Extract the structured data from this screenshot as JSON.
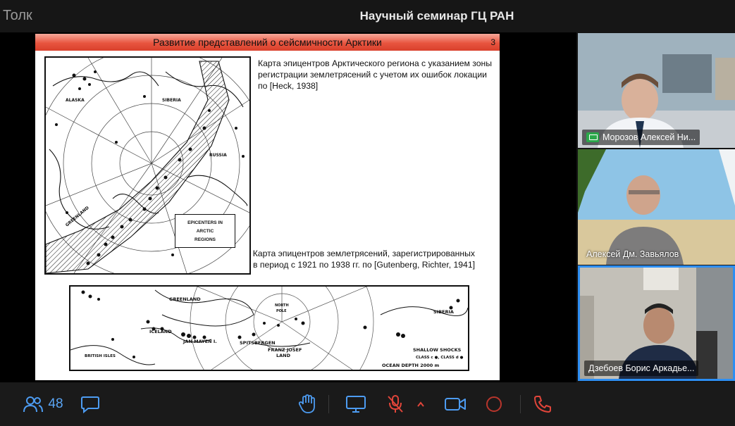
{
  "app": {
    "name": "Толк",
    "meeting_title": "Научный семинар ГЦ РАН"
  },
  "slide": {
    "title": "Развитие представлений о сейсмичности Арктики",
    "page_number": "3",
    "caption_top": "Карта эпицентров Арктического региона с указанием зоны регистрации землетрясений с учетом их ошибок локации по [Heck, 1938]",
    "caption_bottom": "Карта эпицентров землетрясений, зарегистрированных в период с 1921 по 1938 гг. по [Gutenberg, Richter, 1941]",
    "map1": {
      "legend_line1": "EPICENTERS IN",
      "legend_line2": "ARCTIC",
      "legend_line3": "REGIONS",
      "label_alaska": "ALASKA",
      "label_siberia": "SIBERIA",
      "label_russia": "RUSSIA",
      "label_greenland": "GREENLAND"
    },
    "map2": {
      "label_greenland": "GREENLAND",
      "label_siberia": "SIBERIA",
      "label_north_pole_1": "NORTH",
      "label_north_pole_2": "POLE",
      "label_iceland": "ICELAND",
      "label_jan_mayen": "JAN MAYEN I.",
      "label_spitsbergen": "SPITSBERGEN",
      "label_franz_josef_1": "FRANZ JOSEF",
      "label_franz_josef_2": "LAND",
      "label_british_isles": "BRITISH ISLES",
      "label_shallow_shocks": "SHALLOW SHOCKS",
      "label_classes": "CLASS c ●, CLASS d ●",
      "label_ocean_depth": "OCEAN DEPTH 2000 m"
    }
  },
  "participants": [
    {
      "name": "Морозов Алексей Ни...",
      "sharing_screen": true
    },
    {
      "name": "Алексей Дм. Завьялов",
      "sharing_screen": false
    },
    {
      "name": "Дзебоев Борис Аркадье...",
      "sharing_screen": false,
      "speaking": true
    }
  ],
  "toolbar": {
    "participants_count": "48",
    "icons": [
      "participants-icon",
      "chat-icon",
      "raise-hand-icon",
      "screen-share-icon",
      "microphone-muted-icon",
      "chevron-up-icon",
      "camera-icon",
      "record-icon",
      "hang-up-icon"
    ],
    "accent_color": "#4d9cf2",
    "muted_color": "#e0453a"
  }
}
